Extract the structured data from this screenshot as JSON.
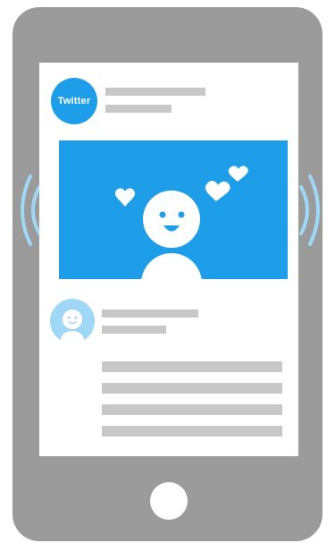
{
  "colors": {
    "phone_body": "#9b9b9b",
    "screen_bg": "#ffffff",
    "accent_blue": "#1e9ee8",
    "light_blue": "#9fd7f7",
    "placeholder_bar": "#c8c8c8",
    "figure_white": "#ffffff"
  },
  "tweet": {
    "brand_label": "Twitter"
  },
  "icons": {
    "left_waves": "vibration-waves-icon",
    "right_waves": "vibration-waves-icon",
    "hearts": "heart-icon",
    "smiley": "smiley-figure",
    "reply_avatar": "smiley-avatar-icon"
  }
}
